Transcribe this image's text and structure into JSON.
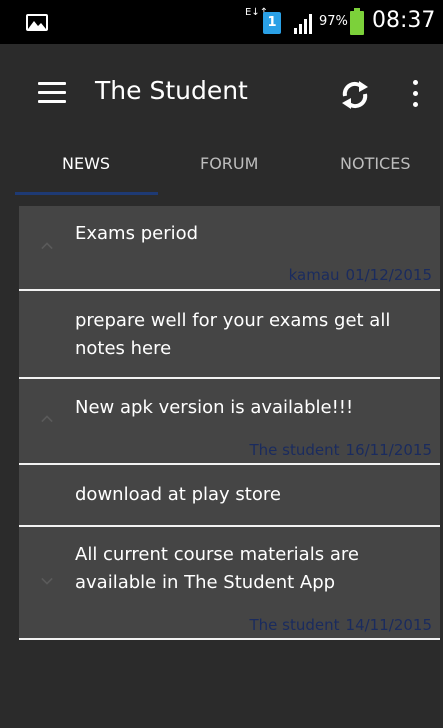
{
  "status_bar": {
    "data_icon": "E↓↑",
    "sim": "1",
    "battery_pct": "97%",
    "time": "08:37"
  },
  "app_bar": {
    "title": "The Student",
    "icons": [
      "menu-icon",
      "refresh-icon",
      "overflow-menu-icon"
    ]
  },
  "tabs": [
    {
      "label": "NEWS",
      "active": true
    },
    {
      "label": "FORUM",
      "active": false
    },
    {
      "label": "NOTICES",
      "active": false
    }
  ],
  "items": [
    {
      "title": "Exams period",
      "author": "kamau",
      "date": "01/12/2015",
      "expanded": true,
      "body": "prepare well for your exams get all notes here"
    },
    {
      "title": "New apk version is available!!!",
      "author": "The student",
      "date": "16/11/2015",
      "expanded": true,
      "body": "download at play store"
    },
    {
      "title": "All current course materials are available in The Student App",
      "author": "The student",
      "date": "14/11/2015",
      "expanded": false
    }
  ]
}
